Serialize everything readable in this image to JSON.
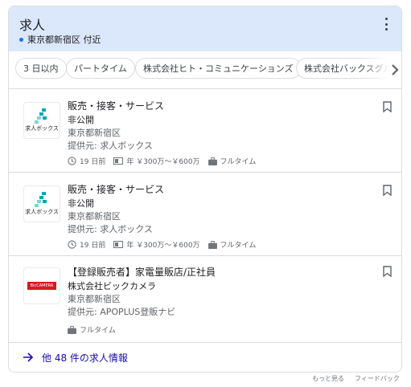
{
  "header": {
    "title": "求人",
    "location": "東京都新宿区 付近"
  },
  "filters": [
    "3 日以内",
    "パートタイム",
    "株式会社ヒト・コミュニケーションズ",
    "株式会社バックスグル"
  ],
  "jobs": [
    {
      "title": "販売・接客・サービス",
      "company": "非公開",
      "location": "東京都新宿区",
      "via": "提供元: 求人ボックス",
      "logo_text": "求人ボックス",
      "posted": "19 日前",
      "salary": "年 ￥300万～￥600万",
      "type": "フルタイム"
    },
    {
      "title": "販売・接客・サービス",
      "company": "非公開",
      "location": "東京都新宿区",
      "via": "提供元: 求人ボックス",
      "logo_text": "求人ボックス",
      "posted": "19 日前",
      "salary": "年 ￥300万～￥600万",
      "type": "フルタイム"
    },
    {
      "title": "【登録販売者】家電量販店/正社員",
      "company": "株式会社ビックカメラ",
      "location": "東京都新宿区",
      "via": "提供元: APOPLUS登販ナビ",
      "logo_text": "BicCAMERA",
      "type": "フルタイム"
    }
  ],
  "footer": {
    "more_jobs": "他 48 件の求人情報"
  },
  "bottom_links": {
    "more": "もっと見る",
    "feedback": "フィードバック"
  },
  "colors": {
    "header_bg": "#dbe8fb",
    "link": "#1a0dab",
    "accent": "#1a73e8",
    "logo_teal": "#00a6b4",
    "logo_red": "#d71920"
  },
  "icons": {
    "clock": "clock-icon",
    "salary": "money-icon",
    "briefcase": "briefcase-icon",
    "bookmark": "bookmark-icon",
    "arrow": "arrow-right-icon",
    "more": "more-vert-icon",
    "chevron": "chevron-right-icon"
  }
}
